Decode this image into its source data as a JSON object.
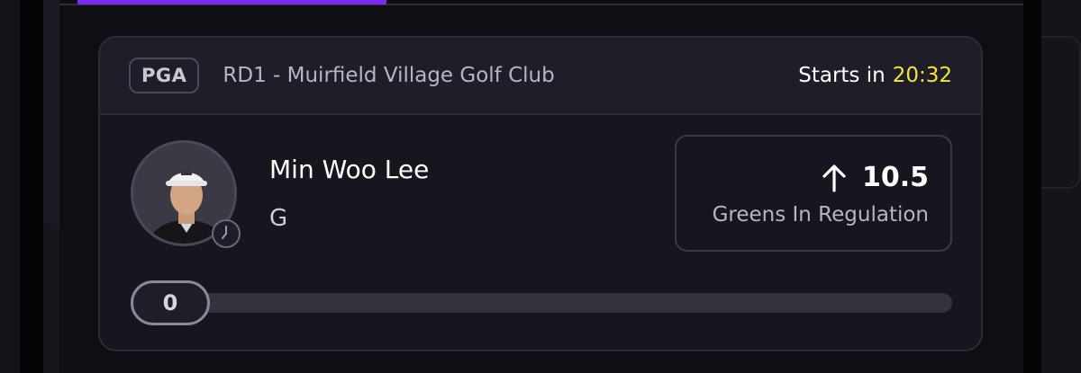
{
  "header": {
    "league": "PGA",
    "event": "RD1 - Muirfield Village Golf Club",
    "starts_label": "Starts in",
    "starts_time": "20:32"
  },
  "player": {
    "name": "Min Woo Lee",
    "position": "G"
  },
  "stat": {
    "direction_icon": "arrow-up-icon",
    "value": "10.5",
    "label": "Greens In Regulation"
  },
  "progress": {
    "count": "0",
    "fraction": 0
  },
  "colors": {
    "accent_purple": "#7c2cf2",
    "countdown_yellow": "#f3e443"
  }
}
